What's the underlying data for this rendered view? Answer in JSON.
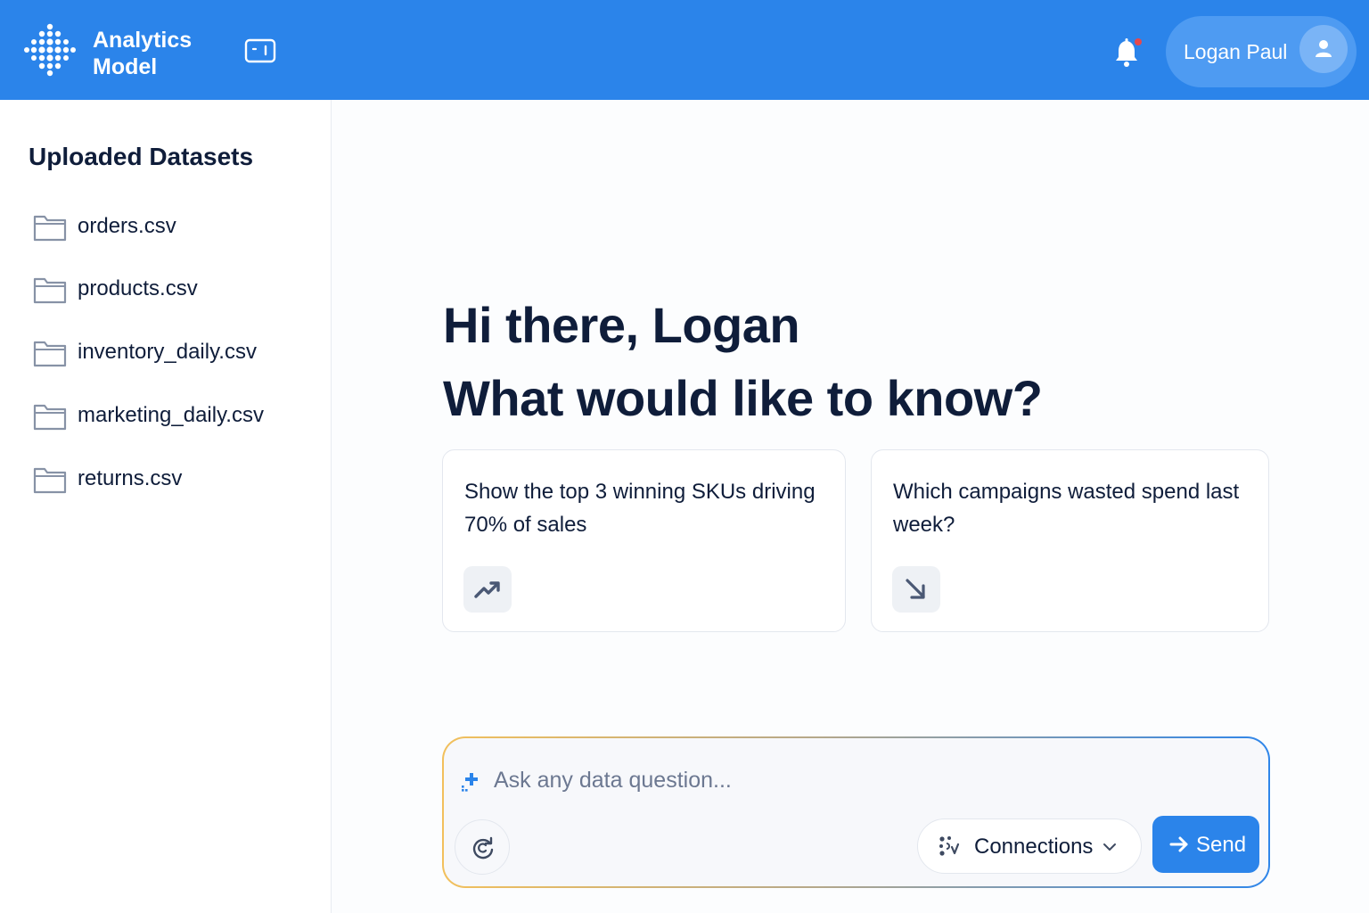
{
  "header": {
    "brand_line1": "Analytics",
    "brand_line2": "Model",
    "user_name": "Logan Paul",
    "accent_color": "#2b84ea",
    "notification_dot_color": "#e5484d"
  },
  "sidebar": {
    "title": "Uploaded Datasets",
    "datasets": [
      {
        "label": "orders.csv",
        "icon": "folder-icon"
      },
      {
        "label": "products.csv",
        "icon": "folder-icon"
      },
      {
        "label": "inventory_daily.csv",
        "icon": "folder-icon"
      },
      {
        "label": "marketing_daily.csv",
        "icon": "folder-icon"
      },
      {
        "label": "returns.csv",
        "icon": "folder-icon"
      }
    ]
  },
  "main": {
    "greeting_line1": "Hi there, Logan",
    "greeting_line2": "What would like to know?",
    "suggestions": [
      {
        "text": "Show the top 3 winning SKUs driving 70% of sales",
        "icon": "trending-up-icon"
      },
      {
        "text": "Which campaigns wasted spend last week?",
        "icon": "arrow-down-right-icon"
      }
    ]
  },
  "prompt": {
    "placeholder": "Ask any data question...",
    "value": "",
    "connections_label": "Connections",
    "send_label": "Send"
  }
}
